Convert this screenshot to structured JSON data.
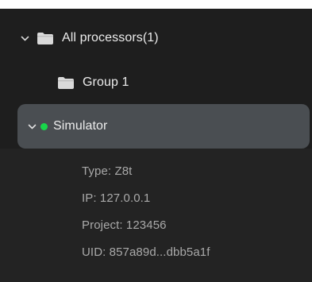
{
  "tree": {
    "root": {
      "label": "All processors(1)",
      "icon": "folder-icon",
      "expanded": true
    },
    "group": {
      "label": "Group 1",
      "icon": "folder-icon"
    },
    "device": {
      "label": "Simulator",
      "status_color": "#18d64a",
      "expanded": true,
      "details": {
        "type": "Type: Z8t",
        "ip": "IP: 127.0.0.1",
        "project": "Project: 123456",
        "uid": "UID: 857a89d...dbb5a1f"
      }
    }
  },
  "colors": {
    "panel_bg": "#1e1e1e",
    "selected_bg": "#4a4e52",
    "text": "#ececec",
    "detail_text": "#a9a9a9",
    "status_online": "#18d64a"
  }
}
